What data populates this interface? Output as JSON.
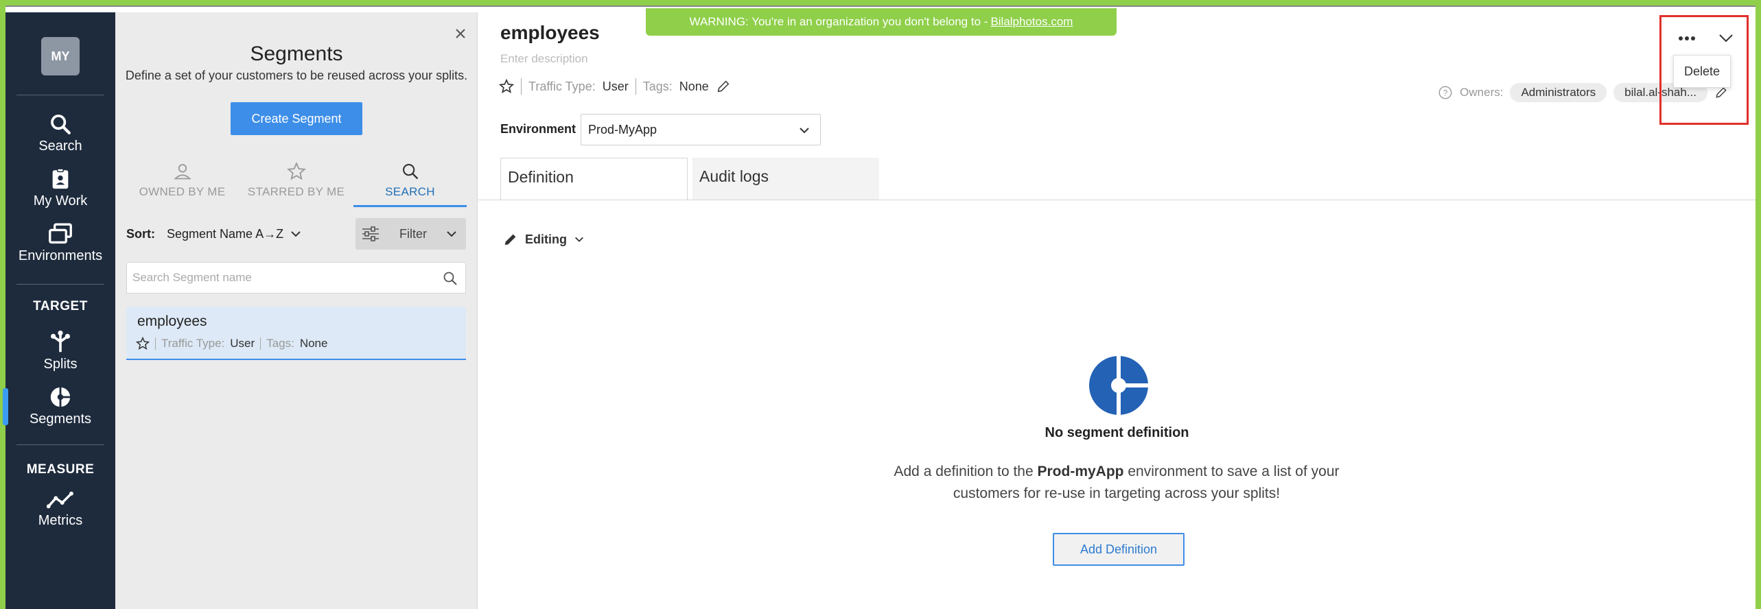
{
  "nav": {
    "avatar": "MY",
    "items": [
      {
        "label": "Search",
        "icon": "search-icon"
      },
      {
        "label": "My Work",
        "icon": "badge-icon"
      },
      {
        "label": "Environments",
        "icon": "windows-icon"
      }
    ],
    "section_target": "TARGET",
    "target_items": [
      {
        "label": "Splits",
        "icon": "split-icon"
      },
      {
        "label": "Segments",
        "icon": "segment-icon"
      }
    ],
    "section_measure": "MEASURE",
    "measure_items": [
      {
        "label": "Metrics",
        "icon": "metrics-icon"
      }
    ]
  },
  "panel": {
    "title": "Segments",
    "subtitle": "Define a set of your customers to be reused across your splits.",
    "create_label": "Create Segment",
    "tabs": [
      {
        "label": "OWNED BY ME"
      },
      {
        "label": "STARRED BY ME"
      },
      {
        "label": "SEARCH"
      }
    ],
    "sort_label": "Sort:",
    "sort_value": "Segment Name A→Z",
    "filter_label": "Filter",
    "search_placeholder": "Search Segment name",
    "items": [
      {
        "name": "employees",
        "traffic_label": "Traffic Type:",
        "traffic_value": "User",
        "tags_label": "Tags:",
        "tags_value": "None"
      }
    ]
  },
  "warning": {
    "text": "WARNING: You're in an organization you don't belong to -",
    "link": "Bilalphotos.com"
  },
  "main": {
    "title": "employees",
    "description_placeholder": "Enter description",
    "traffic_label": "Traffic Type:",
    "traffic_value": "User",
    "tags_label": "Tags:",
    "tags_value": "None",
    "owners_label": "Owners:",
    "owners": [
      "Administrators",
      "bilal.al-shah..."
    ],
    "env_label": "Environment",
    "env_value": "Prod-MyApp",
    "tabs": [
      "Definition",
      "Audit logs"
    ],
    "editing_label": "Editing",
    "empty_title": "No segment definition",
    "empty_text_1": "Add a definition to the",
    "empty_env": "Prod-myApp",
    "empty_text_2": "environment to save a list of your customers for re-use in targeting across your splits!",
    "add_label": "Add Definition",
    "menu_delete": "Delete"
  },
  "colors": {
    "accent": "#3d8ee8",
    "nav_bg": "#1e2b3d",
    "warning_bg": "#8fcf4a",
    "highlight": "#e0302a",
    "segment_logo": "#2362b5"
  }
}
